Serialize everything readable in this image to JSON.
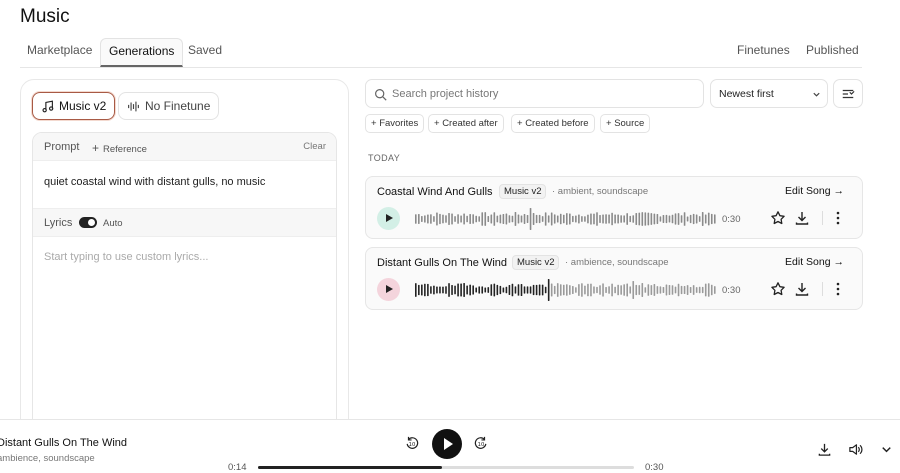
{
  "app": {
    "title": "Music"
  },
  "tabs": [
    {
      "label": "Marketplace",
      "active": false
    },
    {
      "label": "Generations",
      "active": true
    },
    {
      "label": "Saved",
      "active": false
    }
  ],
  "right_tabs": [
    {
      "label": "Finetunes"
    },
    {
      "label": "Published"
    }
  ],
  "composer": {
    "model_active": "Music v2",
    "model_finetune": "No Finetune",
    "prompt_label": "Prompt",
    "reference_label": "Reference",
    "clear_label": "Clear",
    "prompt_text": "quiet coastal wind with distant gulls, no music",
    "lyrics_label": "Lyrics",
    "auto_label": "Auto",
    "lyrics_toggle_on": true,
    "lyrics_placeholder": "Start typing to use custom lyrics..."
  },
  "history": {
    "search_placeholder": "Search project history",
    "sort_value": "Newest first",
    "filters": [
      {
        "label": "Favorites"
      },
      {
        "label": "Created after"
      },
      {
        "label": "Created before"
      },
      {
        "label": "Source"
      }
    ],
    "section_label": "TODAY",
    "items": [
      {
        "title": "Coastal Wind And Gulls",
        "model": "Music v2",
        "tags": "· ambient, soundscape",
        "edit_label": "Edit Song →",
        "duration": "0:30",
        "play_color": "#d3efe6"
      },
      {
        "title": "Distant Gulls On The Wind",
        "model": "Music v2",
        "tags": "· ambience, soundscape",
        "edit_label": "Edit Song →",
        "duration": "0:30",
        "play_color": "#f4d4dc"
      }
    ]
  },
  "player": {
    "title": "Distant Gulls On The Wind",
    "tags": "ambience, soundscape",
    "current_time": "0:14",
    "total_time": "0:30",
    "progress": 0.49
  },
  "colors": {
    "accent_border": "#a85a45",
    "text_primary": "#111111"
  },
  "icons": [
    "music-note-icon",
    "waveform-icon",
    "plus-icon",
    "search-icon",
    "chevron-down-icon",
    "sliders-icon",
    "play-icon",
    "star-icon",
    "download-icon",
    "more-vertical-icon",
    "rewind-10-icon",
    "forward-10-icon",
    "volume-icon"
  ]
}
